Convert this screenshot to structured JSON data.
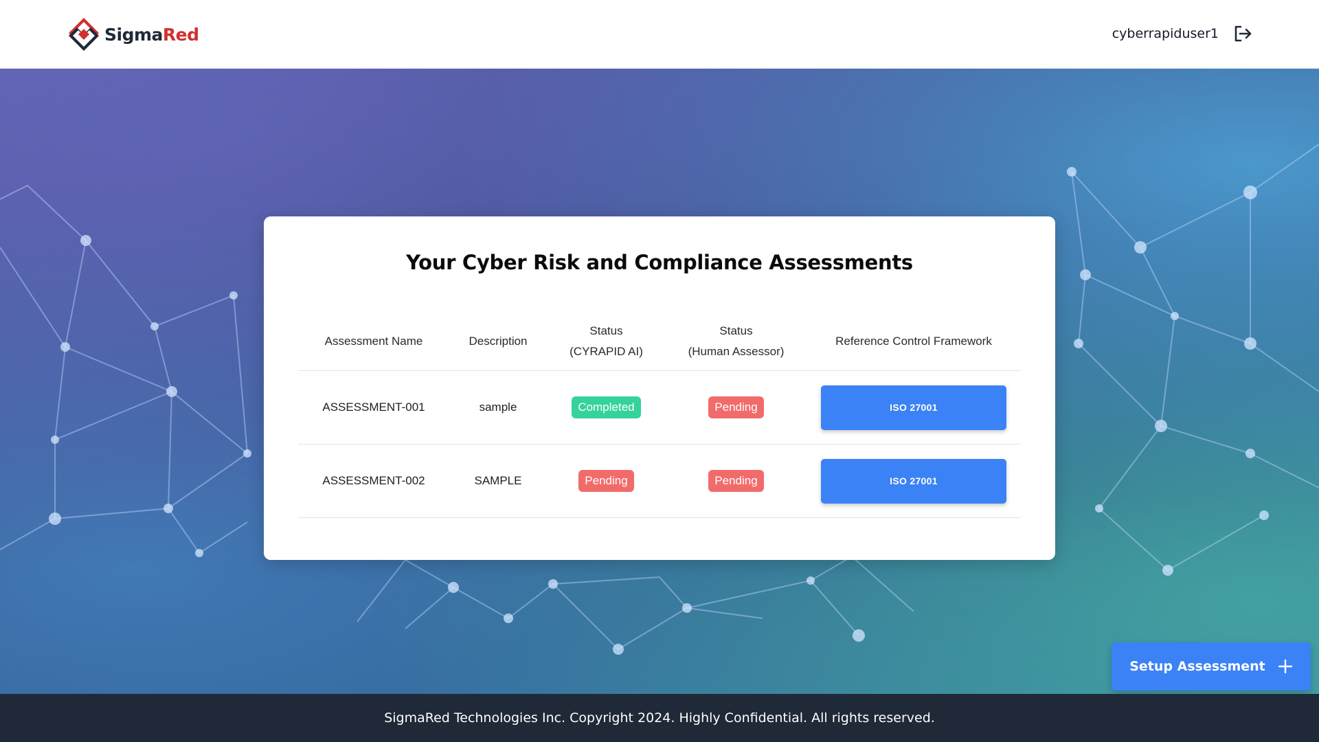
{
  "header": {
    "logo_part1": "Sigma",
    "logo_part2": "Red",
    "username": "cyberrapiduser1",
    "logout_icon": "logout-icon"
  },
  "main": {
    "title": "Your Cyber Risk and Compliance Assessments",
    "columns": {
      "name": "Assessment Name",
      "description": "Description",
      "status_ai_line1": "Status",
      "status_ai_line2": "(CYRAPID AI)",
      "status_human_line1": "Status",
      "status_human_line2": "(Human Assessor)",
      "framework": "Reference Control Framework"
    },
    "rows": [
      {
        "name": "ASSESSMENT-001",
        "description": "sample",
        "status_ai": "Completed",
        "status_human": "Pending",
        "framework": "ISO 27001"
      },
      {
        "name": "ASSESSMENT-002",
        "description": "SAMPLE",
        "status_ai": "Pending",
        "status_human": "Pending",
        "framework": "ISO 27001"
      }
    ]
  },
  "setup_button": {
    "label": "Setup Assessment",
    "icon": "plus-icon"
  },
  "footer": {
    "text": "SigmaRed Technologies Inc. Copyright 2024. Highly Confidential. All rights reserved."
  },
  "colors": {
    "primary": "#3b82f6",
    "completed": "#34d399",
    "pending": "#f26b6b",
    "footer_bg": "#1f2937",
    "brand_red": "#d32f2f"
  }
}
